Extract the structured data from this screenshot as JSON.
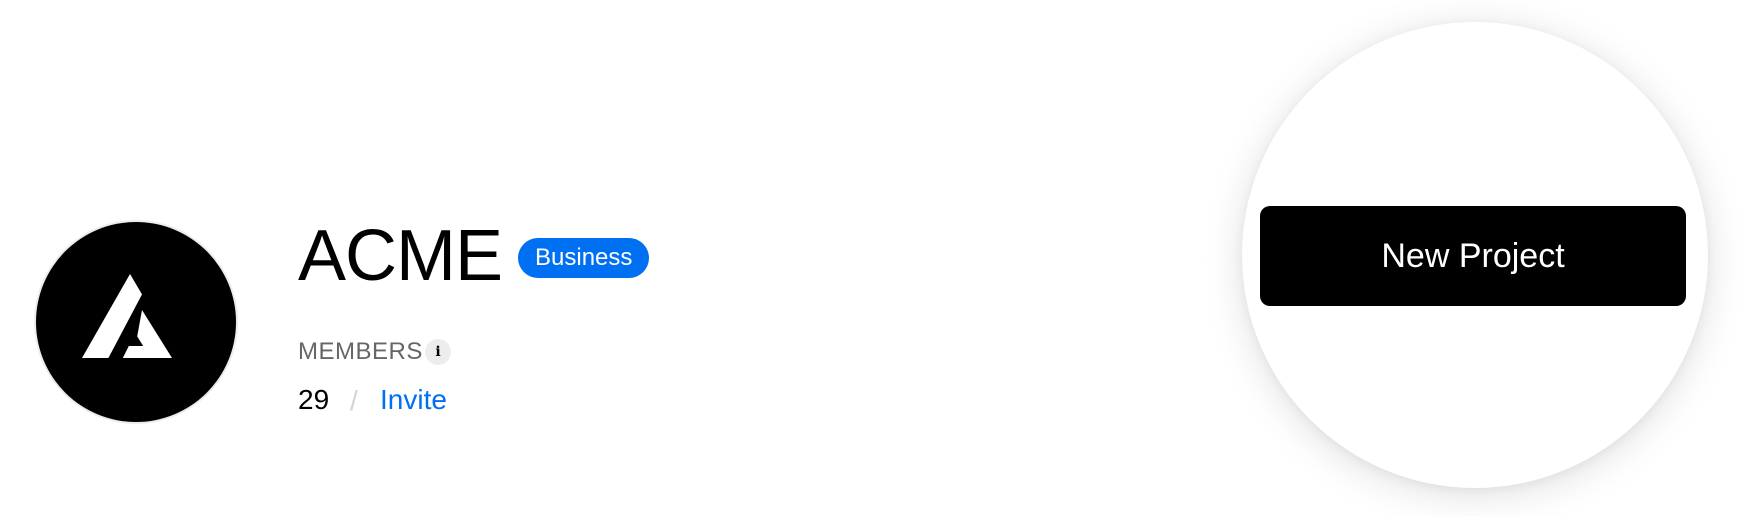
{
  "team": {
    "logo_icon": "acme-triangle-logo-icon",
    "name": "ACME",
    "plan_badge": "Business",
    "plan_badge_color": "#0070f3"
  },
  "members": {
    "label": "MEMBERS",
    "info_icon": "info-icon",
    "info_glyph": "i",
    "count": "29",
    "separator": "/",
    "invite_label": "Invite",
    "invite_color": "#0070f3"
  },
  "actions": {
    "new_project_label": "New Project"
  }
}
